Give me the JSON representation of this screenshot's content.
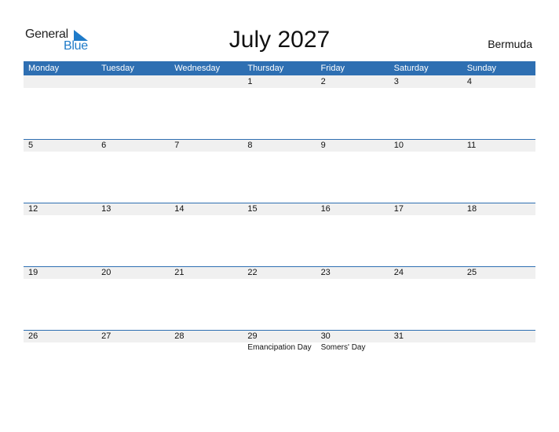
{
  "logo": {
    "word1": "General",
    "word2": "Blue"
  },
  "title": "July 2027",
  "country": "Bermuda",
  "colors": {
    "header_bg": "#2e6fb2",
    "band_bg": "#f0f0f0",
    "logo_blue": "#1f7bc9"
  },
  "weekdays": [
    "Monday",
    "Tuesday",
    "Wednesday",
    "Thursday",
    "Friday",
    "Saturday",
    "Sunday"
  ],
  "weeks": [
    {
      "days": [
        {
          "num": ""
        },
        {
          "num": ""
        },
        {
          "num": ""
        },
        {
          "num": "1"
        },
        {
          "num": "2"
        },
        {
          "num": "3"
        },
        {
          "num": "4"
        }
      ]
    },
    {
      "days": [
        {
          "num": "5"
        },
        {
          "num": "6"
        },
        {
          "num": "7"
        },
        {
          "num": "8"
        },
        {
          "num": "9"
        },
        {
          "num": "10"
        },
        {
          "num": "11"
        }
      ]
    },
    {
      "days": [
        {
          "num": "12"
        },
        {
          "num": "13"
        },
        {
          "num": "14"
        },
        {
          "num": "15"
        },
        {
          "num": "16"
        },
        {
          "num": "17"
        },
        {
          "num": "18"
        }
      ]
    },
    {
      "days": [
        {
          "num": "19"
        },
        {
          "num": "20"
        },
        {
          "num": "21"
        },
        {
          "num": "22"
        },
        {
          "num": "23"
        },
        {
          "num": "24"
        },
        {
          "num": "25"
        }
      ]
    },
    {
      "days": [
        {
          "num": "26"
        },
        {
          "num": "27"
        },
        {
          "num": "28"
        },
        {
          "num": "29",
          "holiday": "Emancipation Day"
        },
        {
          "num": "30",
          "holiday": "Somers' Day"
        },
        {
          "num": "31"
        },
        {
          "num": ""
        }
      ]
    }
  ]
}
